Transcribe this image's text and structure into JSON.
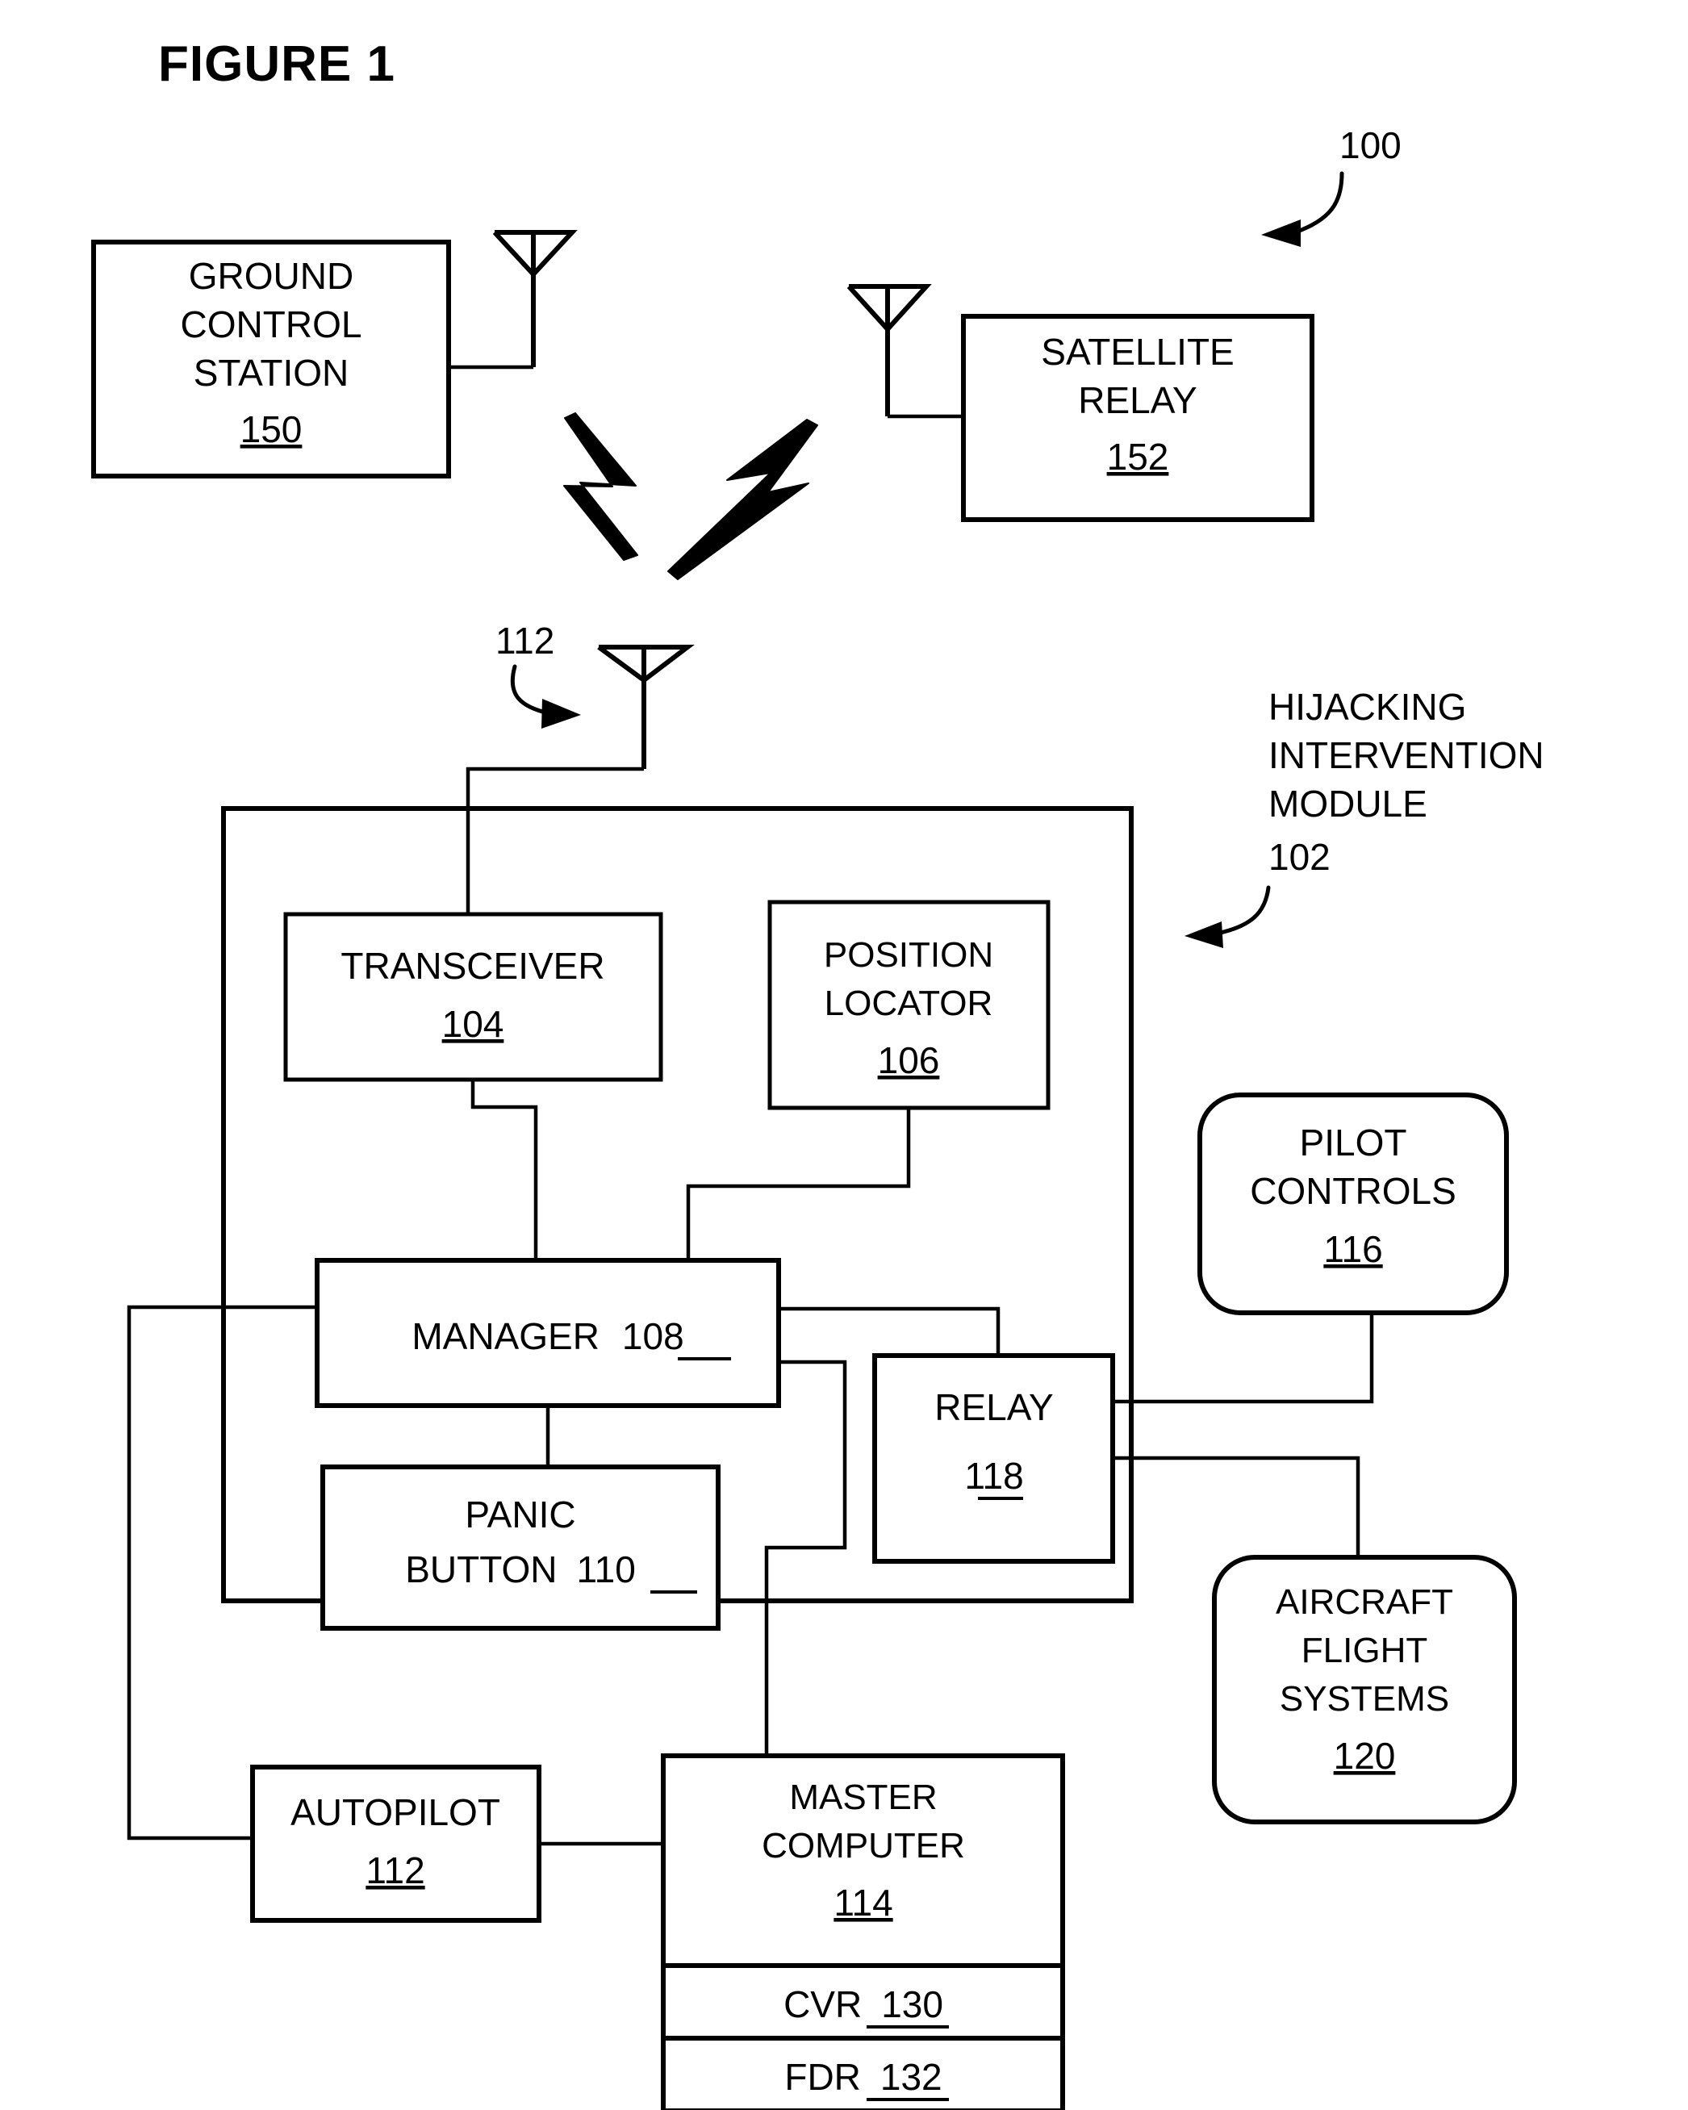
{
  "figure": {
    "title": "FIGURE 1",
    "system_ref": "100"
  },
  "callouts": {
    "antenna_112": "112",
    "module_name_line1": "HIJACKING",
    "module_name_line2": "INTERVENTION",
    "module_name_line3": "MODULE",
    "module_ref": "102"
  },
  "blocks": {
    "ground_control_station": {
      "line1": "GROUND",
      "line2": "CONTROL",
      "line3": "STATION",
      "ref": "150"
    },
    "satellite_relay": {
      "line1": "SATELLITE",
      "line2": "RELAY",
      "ref": "152"
    },
    "transceiver": {
      "line1": "TRANSCEIVER",
      "ref": "104"
    },
    "position_locator": {
      "line1": "POSITION",
      "line2": "LOCATOR",
      "ref": "106"
    },
    "manager": {
      "line1": "MANAGER",
      "ref": "108"
    },
    "panic_button": {
      "line1": "PANIC",
      "line2": "BUTTON",
      "ref": "110"
    },
    "relay": {
      "line1": "RELAY",
      "ref": "118"
    },
    "pilot_controls": {
      "line1": "PILOT",
      "line2": "CONTROLS",
      "ref": "116"
    },
    "aircraft_flight_systems": {
      "line1": "AIRCRAFT",
      "line2": "FLIGHT",
      "line3": "SYSTEMS",
      "ref": "120"
    },
    "autopilot": {
      "line1": "AUTOPILOT",
      "ref": "112"
    },
    "master_computer": {
      "line1": "MASTER",
      "line2": "COMPUTER",
      "ref": "114"
    },
    "cvr": {
      "line1": "CVR",
      "ref": "130"
    },
    "fdr": {
      "line1": "FDR",
      "ref": "132"
    }
  },
  "colors": {
    "ink": "#000000",
    "paper": "#ffffff"
  }
}
